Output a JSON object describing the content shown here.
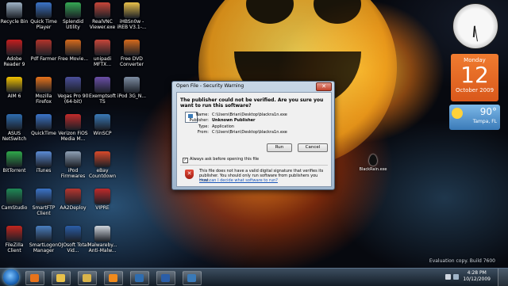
{
  "desktop": {
    "icons": [
      {
        "label": "Recycle Bin",
        "color": "#9fb3c6"
      },
      {
        "label": "Quick Time Player",
        "color": "#3b74c8"
      },
      {
        "label": "Splendid Utility",
        "color": "#35a853"
      },
      {
        "label": "RealVNC Viewer.exe",
        "color": "#c8463a"
      },
      {
        "label": "iHBSn0w -iREB V3.1-...",
        "color": "#e9c14a"
      },
      {
        "label": "Adobe Reader 9",
        "color": "#c41e1e"
      },
      {
        "label": "Pdf Farmer",
        "color": "#b3342b"
      },
      {
        "label": "Free Movie...",
        "color": "#d66a1c"
      },
      {
        "label": "unipadi MFTX...",
        "color": "#c8463a"
      },
      {
        "label": "Free DVD Converter",
        "color": "#d66a1c"
      },
      {
        "label": "AIM 6",
        "color": "#f2c200"
      },
      {
        "label": "Mozilla Firefox",
        "color": "#e8731b"
      },
      {
        "label": "Vegas Pro 90 (64-bit)",
        "color": "#4b4f9b"
      },
      {
        "label": "Exemptsoft TS",
        "color": "#6b4fa8"
      },
      {
        "label": "iPod 3G_N...",
        "color": "#7f8ea3"
      },
      {
        "label": "ASUS NetSwitch",
        "color": "#2f6db0"
      },
      {
        "label": "QuickTime",
        "color": "#3b74c8"
      },
      {
        "label": "Verizon FiOS Media M...",
        "color": "#c22b2b"
      },
      {
        "label": "WinSCP",
        "color": "#3a7ab8"
      },
      {
        "label": "BitTorrent",
        "color": "#2fa84a"
      },
      {
        "label": "iTunes",
        "color": "#5b8bd4"
      },
      {
        "label": "iPod Firmwares",
        "color": "#8fa0b5"
      },
      {
        "label": "eBay Countdown",
        "color": "#d94a2b"
      },
      {
        "label": "CamStudio",
        "color": "#1f8a56"
      },
      {
        "label": "SmartFTP Client",
        "color": "#3b74c8"
      },
      {
        "label": "AA2Deploy",
        "color": "#b7362f"
      },
      {
        "label": "VIPRE",
        "color": "#c02a2a"
      },
      {
        "label": "FileZilla Client",
        "color": "#c3261e"
      },
      {
        "label": "SmartLogon Manager",
        "color": "#4a7fc0"
      },
      {
        "label": "OJOsoft Total Vid...",
        "color": "#2b5ea8"
      },
      {
        "label": "Malwareby... Anti-Malw...",
        "color": "#d0d6de"
      }
    ],
    "drop_shortcut_label": "BlackRain.exe"
  },
  "gadgets": {
    "calendar": {
      "month": "Monday",
      "day": "12",
      "month_year": "October 2009"
    },
    "weather": {
      "temp": "90°",
      "city": "Tampa, FL"
    }
  },
  "dialog": {
    "title": "Open File - Security Warning",
    "close": "✕",
    "heading": "The publisher could not be verified.  Are you sure you want to run this software?",
    "props": [
      {
        "k": "Name:",
        "v": "C:\\Users\\Brian\\Desktop\\blackra1n.exe",
        "bold": false
      },
      {
        "k": "Publisher:",
        "v": "Unknown Publisher",
        "bold": true
      },
      {
        "k": "Type:",
        "v": "Application",
        "bold": false
      },
      {
        "k": "From:",
        "v": "C:\\Users\\Brian\\Desktop\\blackra1n.exe",
        "bold": false
      }
    ],
    "run": "Run",
    "cancel": "Cancel",
    "checkbox_mark": "✓",
    "checkbox_label": "Always ask before opening this file",
    "footer": "This file does not have a valid digital signature that verifies its publisher. You should only run software from publishers you trust.",
    "link": "How can I decide what software to run?"
  },
  "taskbar": {
    "time": "4:28 PM",
    "date": "10/12/2009",
    "eval": "Evaluation copy. Build 7600",
    "buttons": [
      {
        "name": "firefox",
        "color": "#e8731b"
      },
      {
        "name": "explorer",
        "color": "#e9c14a"
      },
      {
        "name": "windows-explorer-folder",
        "color": "#d9b44a"
      },
      {
        "name": "vlc",
        "color": "#f08a1c"
      },
      {
        "name": "media-player",
        "color": "#2f6db0"
      },
      {
        "name": "word",
        "color": "#2b5ea8"
      },
      {
        "name": "remote-app",
        "color": "#3a7ab8"
      }
    ]
  }
}
